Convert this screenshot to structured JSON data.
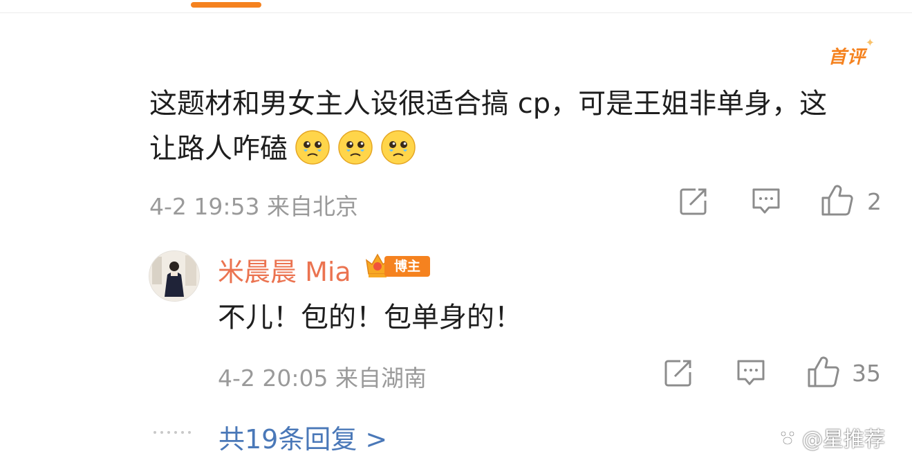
{
  "header": {
    "active_tab_indicator": "tab-indicator"
  },
  "comment": {
    "badge": "首评",
    "text": "这题材和男女主人设很适合搞 cp，可是王姐非单身，这让路人咋磕",
    "emojis": [
      "crying-face-emoji",
      "crying-face-emoji",
      "crying-face-emoji"
    ],
    "timestamp": "4-2 19:53",
    "location": "来自北京",
    "like_count": "2"
  },
  "reply": {
    "username": "米晨晨 Mia",
    "role_badge": "博主",
    "text": "不儿！包的！包单身的！",
    "timestamp": "4-2 20:05",
    "location": "来自湖南",
    "like_count": "35"
  },
  "more_replies": "共19条回复 >",
  "watermark": "@星推荐",
  "colors": {
    "accent": "#f5821f",
    "username": "#eb7350",
    "link": "#4a78b8",
    "meta_text": "#9a9a9a"
  },
  "icons": {
    "share": "share-icon",
    "comment": "comment-icon",
    "like": "like-icon"
  }
}
